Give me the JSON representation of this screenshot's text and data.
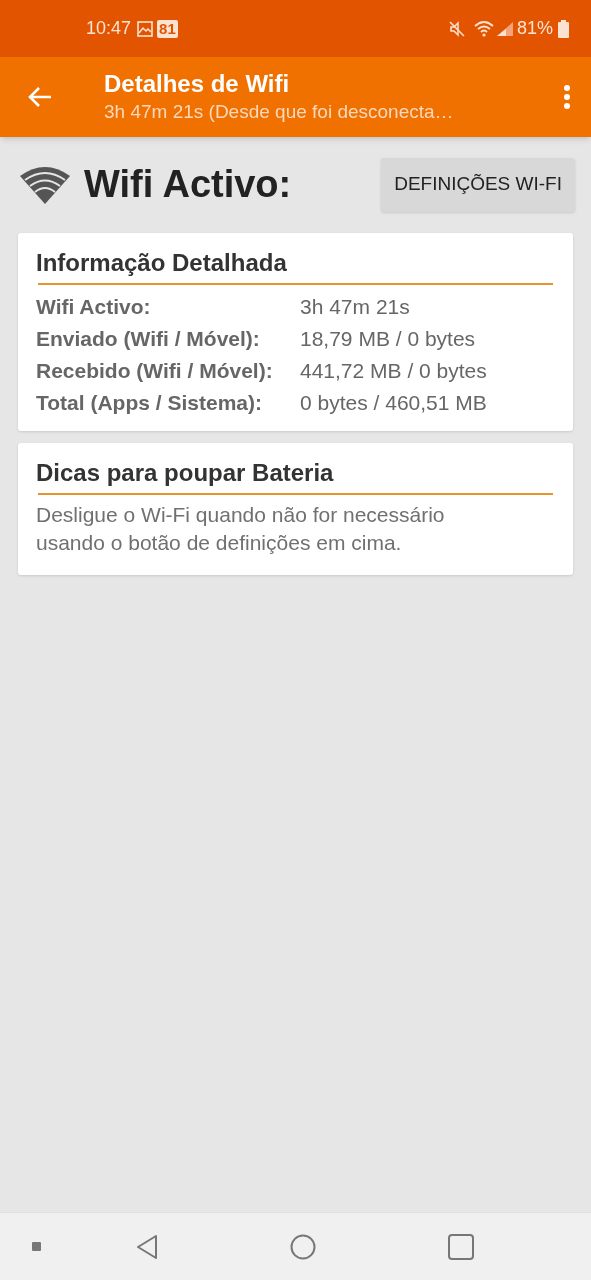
{
  "status_bar": {
    "time": "10:47",
    "calendar_day": "81",
    "battery": "81%"
  },
  "app_bar": {
    "title": "Detalhes de Wifi",
    "subtitle": "3h 47m 21s (Desde que foi desconecta…"
  },
  "header": {
    "title": "Wifi Activo:",
    "button": "DEFINIÇÕES WI-FI"
  },
  "cards": [
    {
      "kind": "table",
      "title": "Informação Detalhada",
      "rows": [
        {
          "label": "Wifi Activo:",
          "value": "3h 47m 21s"
        },
        {
          "label": "Enviado (Wifi / Móvel):",
          "value": "18,79 MB / 0 bytes"
        },
        {
          "label": "Recebido (Wifi / Móvel):",
          "value": "441,72 MB / 0 bytes"
        },
        {
          "label": "Total (Apps / Sistema):",
          "value": "0 bytes / 460,51 MB"
        }
      ]
    },
    {
      "kind": "text",
      "title": "Dicas para poupar Bateria",
      "text": "Desligue o Wi-Fi quando não for necessário usando o botão de definições em cima."
    }
  ]
}
